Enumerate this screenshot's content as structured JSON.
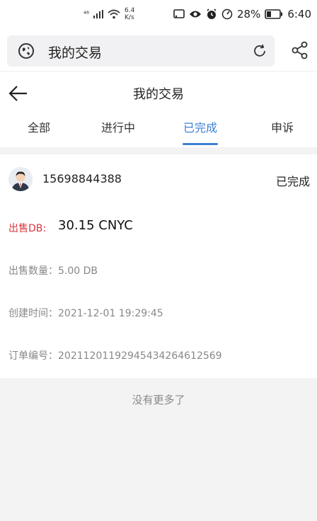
{
  "status_bar": {
    "network_label": "⁴⁶",
    "speed_value": "6.4",
    "speed_unit": "K/s",
    "battery_percent": "28%",
    "time": "6:40"
  },
  "browser": {
    "url_text": "我的交易"
  },
  "header": {
    "title": "我的交易"
  },
  "tabs": [
    {
      "label": "全部"
    },
    {
      "label": "进行中"
    },
    {
      "label": "已完成"
    },
    {
      "label": "申诉"
    }
  ],
  "active_tab": "已完成",
  "accent_color": "#3d7fd6",
  "order": {
    "phone": "15698844388",
    "status": "已完成",
    "sell_label": "出售DB:",
    "sell_value": "30.15 CNYC",
    "quantity": "出售数量：5.00 DB",
    "created": "创建时间：2021-12-01 19:29:45",
    "order_no": "订单编号：20211201192945434264612569"
  },
  "footer": {
    "no_more": "没有更多了"
  }
}
